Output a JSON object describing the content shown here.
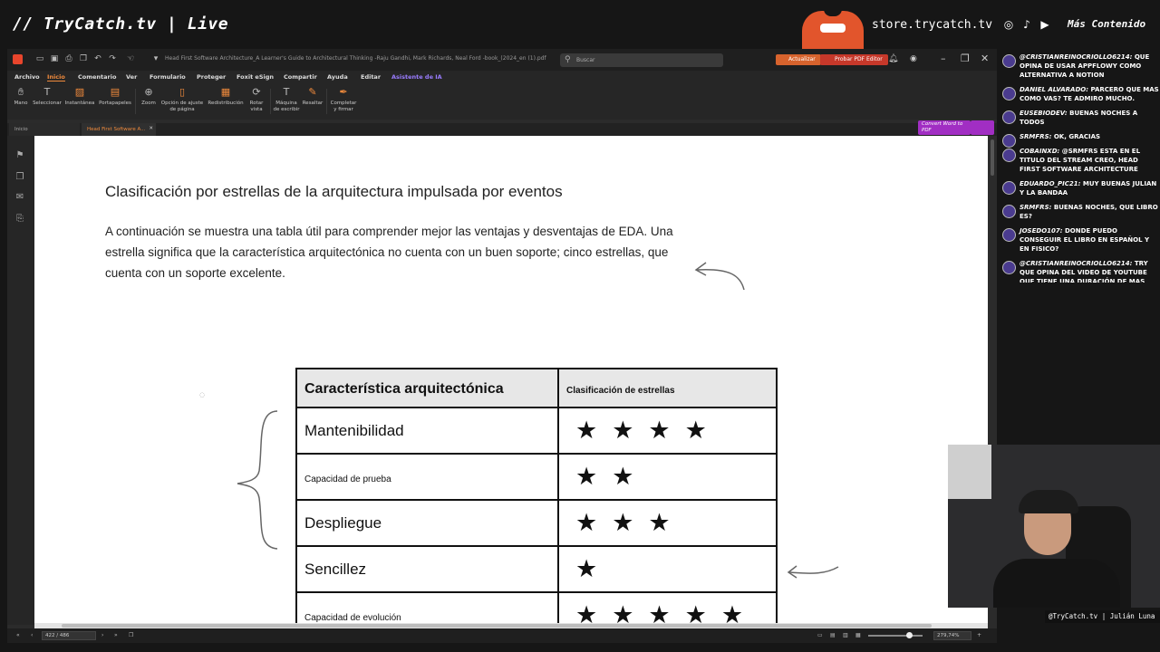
{
  "stream": {
    "brand": "// TryCatch.tv | Live",
    "store_url": "store.trycatch.tv",
    "more_content": "Más Contenido",
    "social_icons": [
      "instagram-icon",
      "tiktok-icon",
      "youtube-icon"
    ]
  },
  "app": {
    "doc_title": "Head First Software Architecture_A Learner's Guide to Architectural Thinking -Raju Gandhi, Mark Richards, Neal Ford -book_(2024_en (1).pdf",
    "search_placeholder": "Buscar",
    "update_button": "Actualizar",
    "try_editor_button": "Probar PDF Editor",
    "menu": [
      "Archivo",
      "Inicio",
      "Comentario",
      "Ver",
      "Formulario",
      "Proteger",
      "Foxit eSign",
      "Compartir",
      "Ayuda",
      "Editar",
      "Asistente de IA"
    ],
    "active_menu": "Inicio",
    "ribbon": [
      {
        "label": "Mano",
        "icon": "hand-icon"
      },
      {
        "label": "Seleccionar",
        "icon": "select-text-icon"
      },
      {
        "label": "Instantánea",
        "icon": "snapshot-icon"
      },
      {
        "label": "Portapapeles",
        "icon": "clipboard-icon"
      },
      {
        "label": "Zoom",
        "icon": "zoom-icon"
      },
      {
        "label": "Opción de ajuste de página",
        "icon": "page-fit-icon"
      },
      {
        "label": "Redistribución",
        "icon": "reflow-icon"
      },
      {
        "label": "Rotar vista",
        "icon": "rotate-icon"
      },
      {
        "label": "Máquina de escribir",
        "icon": "typewriter-icon"
      },
      {
        "label": "Resaltar",
        "icon": "highlight-icon"
      },
      {
        "label": "Completar y firmar",
        "icon": "fill-sign-icon"
      }
    ],
    "tabs": {
      "home": "Inicio",
      "doc": "Head First Software A..."
    },
    "convert_label": "Convert Word to PDF",
    "status": {
      "page": "422 / 486",
      "zoom": "279,74%"
    }
  },
  "document": {
    "heading": "Clasificación por estrellas de la arquitectura impulsada por eventos",
    "paragraph": "A continuación se muestra una tabla útil para comprender mejor las ventajas y desventajas de EDA. Una estrella significa que la característica arquitectónica no cuenta con un buen soporte; cinco estrellas, que cuenta con un soporte excelente.",
    "table": {
      "header": [
        "Característica arquitectónica",
        "Clasificación de estrellas"
      ],
      "rows": [
        {
          "name": "Mantenibilidad",
          "stars": "★★★★",
          "star_count": 4
        },
        {
          "name": "Capacidad de prueba",
          "stars": "★★",
          "star_count": 2
        },
        {
          "name": "Despliegue",
          "stars": "★★★",
          "star_count": 3
        },
        {
          "name": "Sencillez",
          "stars": "★",
          "star_count": 1
        },
        {
          "name": "Capacidad de evolución",
          "stars": "★★★★★",
          "star_count": 5
        }
      ]
    }
  },
  "chat": [
    {
      "user": "@CristianReinoCriollo6214:",
      "text": "que opina de usar AppFlowy como alternativa a Notion"
    },
    {
      "user": "Daniel Alvarado:",
      "text": "Parcero que mas como vas? te admiro mucho."
    },
    {
      "user": "eusebiodev:",
      "text": "Buenas noches a todos"
    },
    {
      "user": "srmfrs:",
      "text": "ok, gracias"
    },
    {
      "user": "cobainxd:",
      "text": "@srmfrs esta en el titulo del stream creo, Head First Software Architecture"
    },
    {
      "user": "Eduardo_Pic21:",
      "text": "muy buenas Julian y la bandaa"
    },
    {
      "user": "srmfrs:",
      "text": "buenas noches, que libro es?"
    },
    {
      "user": "josedo107:",
      "text": "Donde puedo conseguir el libro en español y en fisico?"
    },
    {
      "user": "@CristianReinoCriollo6214:",
      "text": "try que opina del video de youtube que tiene una duración de mas años y tiene como"
    }
  ],
  "webcam": {
    "caption": "@TryCatch.tv | Julián Luna"
  }
}
